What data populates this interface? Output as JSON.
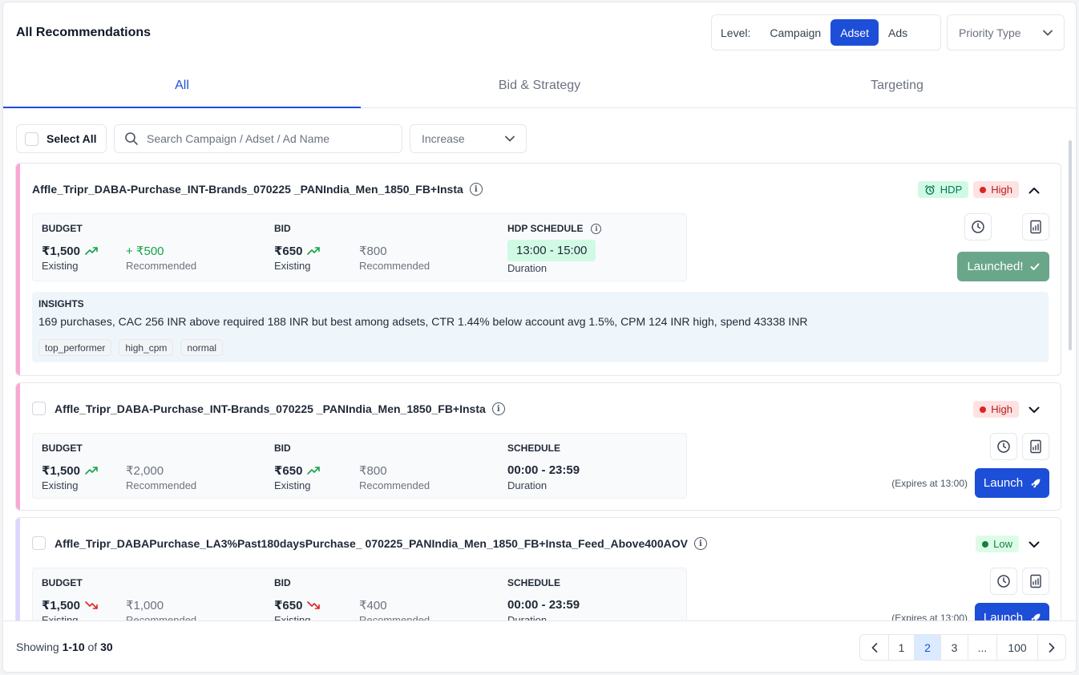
{
  "header": {
    "title": "All Recommendations",
    "level_label": "Level:",
    "levels": [
      "Campaign",
      "Adset",
      "Ads"
    ],
    "active_level": "Adset",
    "priority_placeholder": "Priority Type"
  },
  "tabs": [
    {
      "label": "All",
      "active": true
    },
    {
      "label": "Bid & Strategy",
      "active": false
    },
    {
      "label": "Targeting",
      "active": false
    }
  ],
  "toolbar": {
    "select_all": "Select All",
    "search_placeholder": "Search Campaign / Adset / Ad Name",
    "direction": "Increase"
  },
  "cards": [
    {
      "name": "Affle_Tripr_DABA-Purchase_INT-Brands_070225 _PANIndia_Men_1850_FB+Insta",
      "hdp_badge": "HDP",
      "priority": "High",
      "budget_label": "BUDGET",
      "budget_existing": "₹1,500",
      "budget_recommended": "+ ₹500",
      "bid_label": "BID",
      "bid_existing": "₹650",
      "bid_recommended": "₹800",
      "schedule_label": "HDP SCHEDULE",
      "schedule": "13:00 - 15:00",
      "existing": "Existing",
      "recommended": "Recommended",
      "duration": "Duration",
      "action": "Launched!",
      "insights_label": "INSIGHTS",
      "insights": "169 purchases, CAC 256 INR above required 188 INR but best among adsets, CTR 1.44% below account avg 1.5%, CPM 124 INR high, spend 43338 INR",
      "tags": [
        "top_performer",
        "high_cpm",
        "normal"
      ]
    },
    {
      "name": "Affle_Tripr_DABA-Purchase_INT-Brands_070225 _PANIndia_Men_1850_FB+Insta",
      "priority": "High",
      "budget_label": "BUDGET",
      "budget_existing": "₹1,500",
      "budget_recommended": "₹2,000",
      "bid_label": "BID",
      "bid_existing": "₹650",
      "bid_recommended": "₹800",
      "schedule_label": "SCHEDULE",
      "schedule": "00:00 - 23:59",
      "existing": "Existing",
      "recommended": "Recommended",
      "duration": "Duration",
      "expires": "(Expires at 13:00)",
      "action": "Launch"
    },
    {
      "name": "Affle_Tripr_DABAPurchase_LA3%Past180daysPurchase_ 070225_PANIndia_Men_1850_FB+Insta_Feed_Above400AOV",
      "priority": "Low",
      "budget_label": "BUDGET",
      "budget_existing": "₹1,500",
      "budget_recommended": "₹1,000",
      "bid_label": "BID",
      "bid_existing": "₹650",
      "bid_recommended": "₹400",
      "schedule_label": "SCHEDULE",
      "schedule": "00:00 - 23:59",
      "existing": "Existing",
      "recommended": "Recommended",
      "duration": "Duration",
      "expires": "(Expires at 13:00)",
      "action": "Launch"
    }
  ],
  "footer": {
    "showing_prefix": "Showing",
    "range": "1-10",
    "of": "of",
    "total": "30",
    "pages": [
      "1",
      "2",
      "3",
      "...",
      "100"
    ],
    "active_page": "2"
  },
  "colors": {
    "accent": "#1d4ed8",
    "high_stripe": "#f9a8d4",
    "low_stripe": "#ddd6fe",
    "launched": "#6aa68a",
    "trend_up": "#16a34a",
    "trend_down": "#dc2626"
  }
}
